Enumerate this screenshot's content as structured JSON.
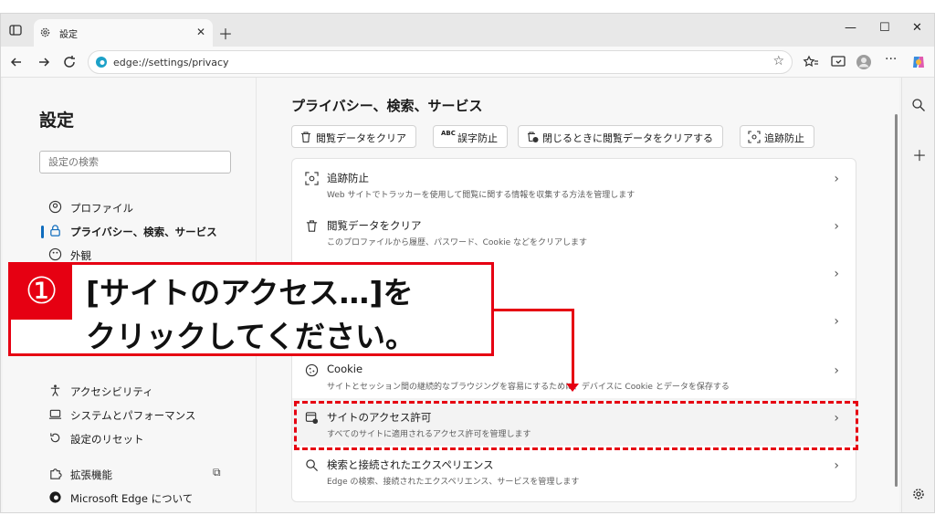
{
  "tab": {
    "title": "設定"
  },
  "address": {
    "url": "edge://settings/privacy"
  },
  "sidebar": {
    "heading": "設定",
    "search_placeholder": "設定の検索",
    "items": [
      {
        "label": "プロファイル"
      },
      {
        "label": "プライバシー、検索、サービス"
      },
      {
        "label": "外観"
      },
      {
        "label": "アクセシビリティ"
      },
      {
        "label": "システムとパフォーマンス"
      },
      {
        "label": "設定のリセット"
      },
      {
        "label": "拡張機能"
      },
      {
        "label": "Microsoft Edge について"
      }
    ]
  },
  "main": {
    "title": "プライバシー、検索、サービス",
    "chips": [
      {
        "label": "閲覧データをクリア"
      },
      {
        "label": "誤字防止"
      },
      {
        "label": "閉じるときに閲覧データをクリアする"
      },
      {
        "label": "追跡防止"
      }
    ],
    "rows": [
      {
        "title": "追跡防止",
        "desc": "Web サイトでトラッカーを使用して閲覧に関する情報を収集する方法を管理します"
      },
      {
        "title": "閲覧データをクリア",
        "desc": "このプロファイルから履歴、パスワード、Cookie などをクリアします"
      },
      {
        "title": "Cookie",
        "desc": "サイトとセッション間の継続的なブラウジングを容易にするために、デバイスに Cookie とデータを保存する"
      },
      {
        "title": "サイトのアクセス許可",
        "desc": "すべてのサイトに適用されるアクセス許可を管理します"
      },
      {
        "title": "検索と接続されたエクスペリエンス",
        "desc": "Edge の検索、接続されたエクスペリエンス、サービスを管理します"
      }
    ]
  },
  "callout": {
    "number": "①",
    "line1": "[サイトのアクセス…]を",
    "line2": "クリックしてください。"
  },
  "colors": {
    "accent": "#0f6cbd",
    "callout": "#e60012"
  }
}
